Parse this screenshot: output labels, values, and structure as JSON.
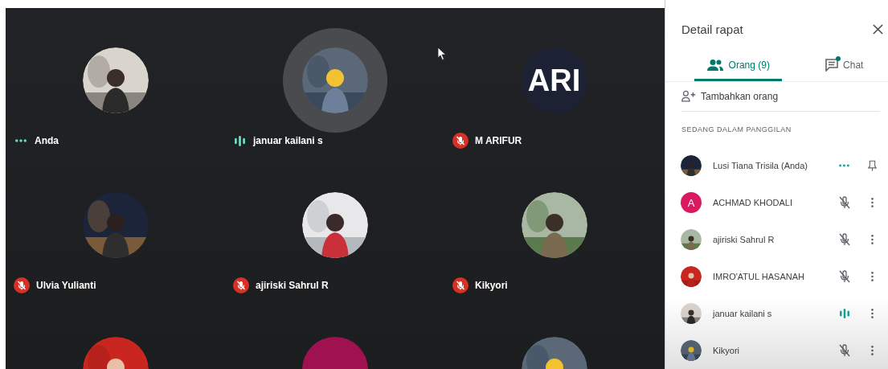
{
  "meeting": {
    "tiles": [
      {
        "name": "Anda",
        "kind": "dots",
        "halo": false
      },
      {
        "name": "januar kailani s",
        "kind": "speaking",
        "halo": true
      },
      {
        "name": "M ARIFUR",
        "kind": "muted",
        "halo": false,
        "avatar": {
          "kind": "letter",
          "text": "ARI",
          "color": "#1c2233"
        }
      },
      {
        "name": "Ulvia Yulianti",
        "kind": "muted",
        "halo": false
      },
      {
        "name": "ajiriski Sahrul R",
        "kind": "muted",
        "halo": false
      },
      {
        "name": "Kikyori",
        "kind": "muted",
        "halo": false
      },
      {
        "halo": false
      },
      {
        "halo": false,
        "avatar": {
          "kind": "letter",
          "color": "#a0124f"
        }
      },
      {
        "halo": false
      }
    ]
  },
  "panel": {
    "title": "Detail rapat",
    "tabs": [
      {
        "label": "Orang (9)",
        "selected": true
      },
      {
        "label": "Chat",
        "selected": false,
        "dot": true
      }
    ],
    "add_person": "Tambahkan orang",
    "section": "SEDANG DALAM PANGGILAN",
    "participants": [
      {
        "name": "Lusi Tiana Trisila (Anda)",
        "kind": "dots",
        "pinnable": true
      },
      {
        "name": "ACHMAD KHODALI",
        "kind": "muted",
        "pinnable": false,
        "avatar": {
          "kind": "letter",
          "text": "A",
          "color": "#d81b60"
        }
      },
      {
        "name": "ajiriski Sahrul R",
        "kind": "muted",
        "pinnable": false
      },
      {
        "name": "IMRO'ATUL HASANAH",
        "kind": "muted",
        "pinnable": false
      },
      {
        "name": "januar kailani s",
        "kind": "speaking",
        "pinnable": false
      },
      {
        "name": "Kikyori",
        "kind": "muted",
        "pinnable": false
      }
    ]
  }
}
